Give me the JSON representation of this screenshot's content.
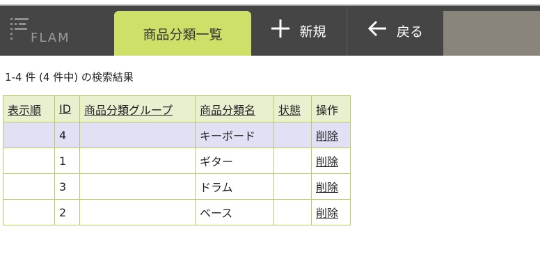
{
  "header": {
    "logo_text": "FLAM",
    "active_tab": "商品分類一覧",
    "new_label": "新規",
    "back_label": "戻る"
  },
  "result_summary": "1-4 件 (4 件中) の検索結果",
  "table": {
    "columns": [
      "表示順",
      "ID",
      "商品分類グループ",
      "商品分類名",
      "状態",
      "操作"
    ],
    "rows": [
      {
        "order": "",
        "id": "4",
        "group": "",
        "name": "キーボード",
        "state": "",
        "action": "削除"
      },
      {
        "order": "",
        "id": "1",
        "group": "",
        "name": "ギター",
        "state": "",
        "action": "削除"
      },
      {
        "order": "",
        "id": "3",
        "group": "",
        "name": "ドラム",
        "state": "",
        "action": "削除"
      },
      {
        "order": "",
        "id": "2",
        "group": "",
        "name": "ベース",
        "state": "",
        "action": "削除"
      }
    ]
  },
  "colors": {
    "header_bg": "#454545",
    "active_tab_bg": "#cfe069",
    "table_border": "#b6cc5c",
    "header_row_bg": "#e9f0cf",
    "highlight_row_bg": "#e2e0f4"
  },
  "icons": {
    "new": "plus-icon",
    "back": "arrow-left-icon"
  }
}
